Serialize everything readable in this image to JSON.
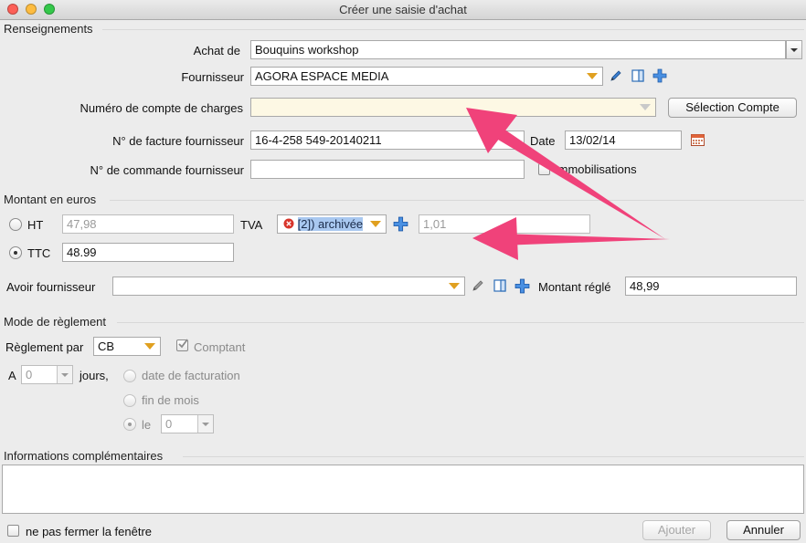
{
  "window": {
    "title": "Créer une saisie d'achat"
  },
  "sections": {
    "renseignements": "Renseignements",
    "montant": "Montant en euros",
    "reglement": "Mode de règlement",
    "infos": "Informations complémentaires"
  },
  "renseignements": {
    "achat_label": "Achat de",
    "achat_value": "Bouquins workshop",
    "fournisseur_label": "Fournisseur",
    "fournisseur_value": "AGORA ESPACE MEDIA",
    "compte_label": "Numéro de compte de charges",
    "compte_value": "",
    "selection_compte_button": "Sélection Compte",
    "facture_label": "N° de facture fournisseur",
    "facture_value": "16-4-258 549-20140211",
    "date_label": "Date",
    "date_value": "13/02/14",
    "commande_label": "N° de commande fournisseur",
    "commande_value": "",
    "immobilisations_label": "Immobilisations"
  },
  "montant": {
    "ht_label": "HT",
    "ht_value": "47,98",
    "tva_label": "TVA",
    "tva_selected": "[2]) archivée",
    "tva_amount": "1,01",
    "ttc_label": "TTC",
    "ttc_value": "48.99",
    "avoir_label": "Avoir fournisseur",
    "avoir_value": "",
    "montant_regle_label": "Montant réglé",
    "montant_regle_value": "48,99"
  },
  "reglement": {
    "reglement_par_label": "Règlement par",
    "reglement_par_value": "CB",
    "comptant_label": "Comptant",
    "a_label": "A",
    "jours_value": "0",
    "jours_label": "jours,",
    "date_facturation_label": "date de facturation",
    "fin_de_mois_label": "fin de mois",
    "le_label": "le",
    "le_value": "0"
  },
  "infos": {
    "text": ""
  },
  "footer": {
    "ne_pas_fermer_label": "ne pas fermer la fenêtre",
    "ajouter_button": "Ajouter",
    "annuler_button": "Annuler"
  },
  "colors": {
    "arrow": "#f0427a",
    "highlight_field": "#fdf8e4",
    "tva_selection": "#a9c8f0",
    "accent_orange": "#e0a020",
    "icon_blue": "#2f7fd8"
  },
  "icons": [
    "close-light",
    "minimize-light",
    "zoom-light",
    "pencil-icon",
    "card-icon",
    "plus-icon",
    "calendar-icon",
    "error-icon"
  ]
}
